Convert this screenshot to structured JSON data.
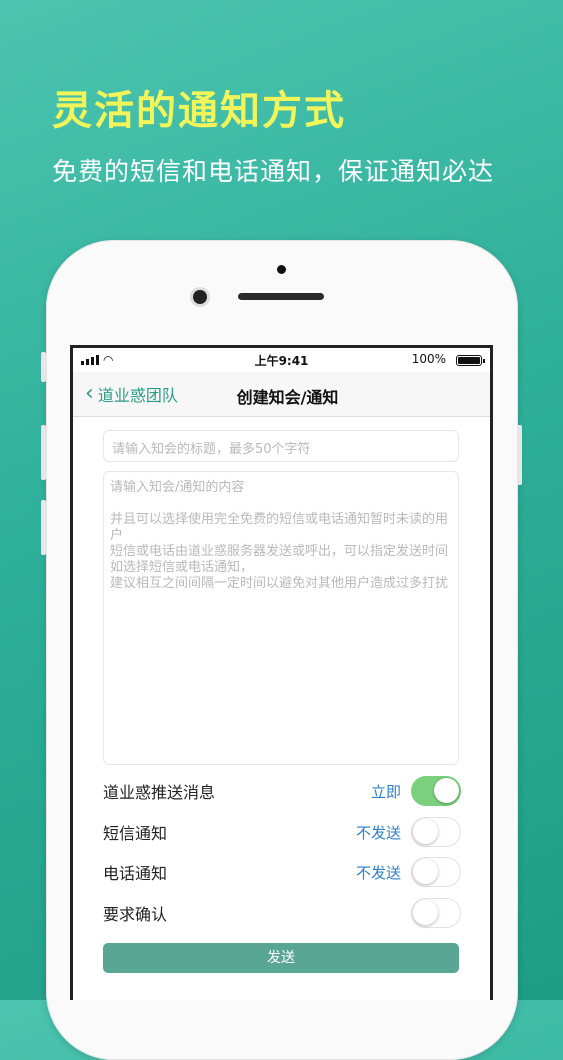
{
  "promo": {
    "headline": "灵活的通知方式",
    "subline": "免费的短信和电话通知，保证通知必达"
  },
  "statusbar": {
    "time": "上午9:41",
    "battery": "100%"
  },
  "navbar": {
    "back_label": "道业惑团队",
    "title": "创建知会/通知"
  },
  "form": {
    "title_placeholder": "请输入知会的标题，最多50个字符",
    "content_placeholder_lines": [
      "请输入知会/通知的内容",
      "",
      "并且可以选择使用完全免费的短信或电话通知暂时未读的用户",
      "短信或电话由道业惑服务器发送或呼出，可以指定发送时间",
      "如选择短信或电话通知，",
      "建议相互之间间隔一定时间以避免对其他用户造成过多打扰"
    ],
    "options": [
      {
        "label": "道业惑推送消息",
        "state": "立即",
        "on": true
      },
      {
        "label": "短信通知",
        "state": "不发送",
        "on": false
      },
      {
        "label": "电话通知",
        "state": "不发送",
        "on": false
      },
      {
        "label": "要求确认",
        "state": "",
        "on": false
      }
    ],
    "send_label": "发送"
  },
  "colors": {
    "accent": "#2c9d84",
    "state_text": "#2c7fc9",
    "toggle_on": "#7bd07d",
    "send_button": "#5aa695",
    "headline": "#f2f55a"
  }
}
